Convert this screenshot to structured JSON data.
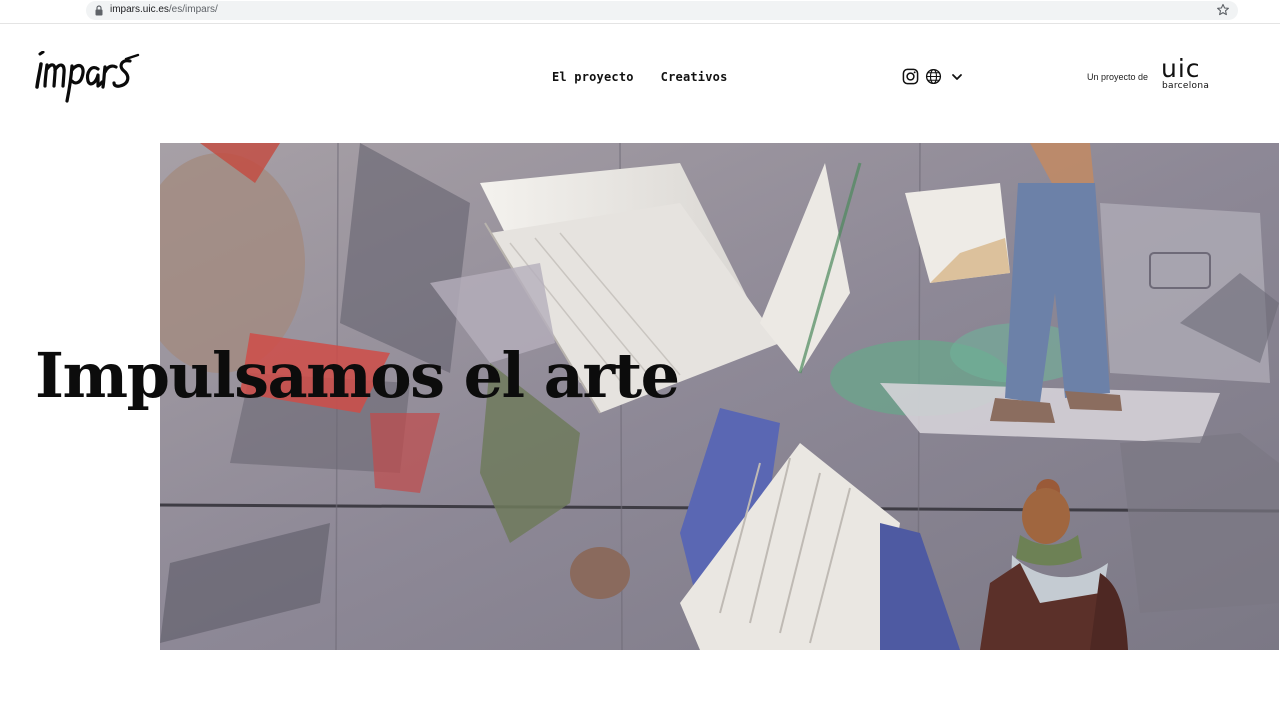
{
  "browser": {
    "url_host": "impars.uic.es",
    "url_path": "/es/impars/"
  },
  "header": {
    "logo_text": "impars",
    "nav": [
      {
        "label": "El proyecto"
      },
      {
        "label": "Creativos"
      }
    ],
    "icons": [
      "instagram-icon",
      "globe-icon",
      "chevron-down-icon"
    ],
    "partner_label": "Un proyecto de",
    "partner_logo": {
      "word": "uic",
      "city": "barcelona"
    }
  },
  "hero": {
    "headline": "Impulsamos el arte",
    "image": "mural-books-street-art"
  },
  "colors": {
    "text": "#111111",
    "hero_bg": "#8c8791",
    "omnibox": "#f1f3f4"
  }
}
